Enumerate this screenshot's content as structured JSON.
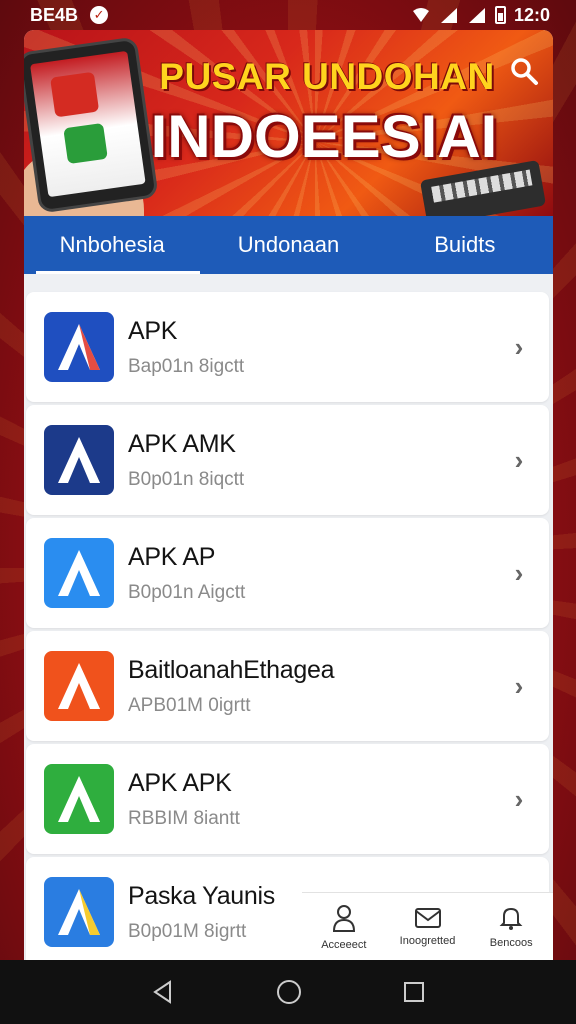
{
  "status_bar": {
    "time_left": "BE4B",
    "time_right": "12:0"
  },
  "banner": {
    "title_line1": "PUSAR UNDOHAN",
    "title_line2": "INDOEESIAI"
  },
  "tabs": [
    {
      "label": "Nnbohesia"
    },
    {
      "label": "Undonaan"
    },
    {
      "label": "Buidts"
    }
  ],
  "apps": [
    {
      "title": "APK",
      "subtitle": "Bap01n 8igctt",
      "icon_color": "#1f4fc0",
      "accent": "#e23a2e",
      "glyph": "A"
    },
    {
      "title": "APK  AMK",
      "subtitle": "B0p01n 8iqctt",
      "icon_color": "#1c3a8a",
      "accent": "#ffffff",
      "glyph": "A"
    },
    {
      "title": "APK AP",
      "subtitle": "B0p01n Aigctt",
      "icon_color": "#2a8df0",
      "accent": "#ffffff",
      "glyph": "A"
    },
    {
      "title": "BaitloanahEthagea",
      "subtitle": "APB01M 0igrtt",
      "icon_color": "#f0521c",
      "accent": "#ffffff",
      "glyph": "A"
    },
    {
      "title": "APK APK",
      "subtitle": "RBBIM 8iantt",
      "icon_color": "#2fae3e",
      "accent": "#ffffff",
      "glyph": "A"
    },
    {
      "title": "Paska Yaunis",
      "subtitle": "B0p01M 8igrtt",
      "icon_color": "#2a7de1",
      "accent": "#f5c518",
      "glyph": "A"
    }
  ],
  "bottom_nav": [
    {
      "label": "Acceeect",
      "icon": "person-icon"
    },
    {
      "label": "Inoogretted",
      "icon": "mail-icon"
    },
    {
      "label": "Bencoos",
      "icon": "bell-icon"
    }
  ]
}
